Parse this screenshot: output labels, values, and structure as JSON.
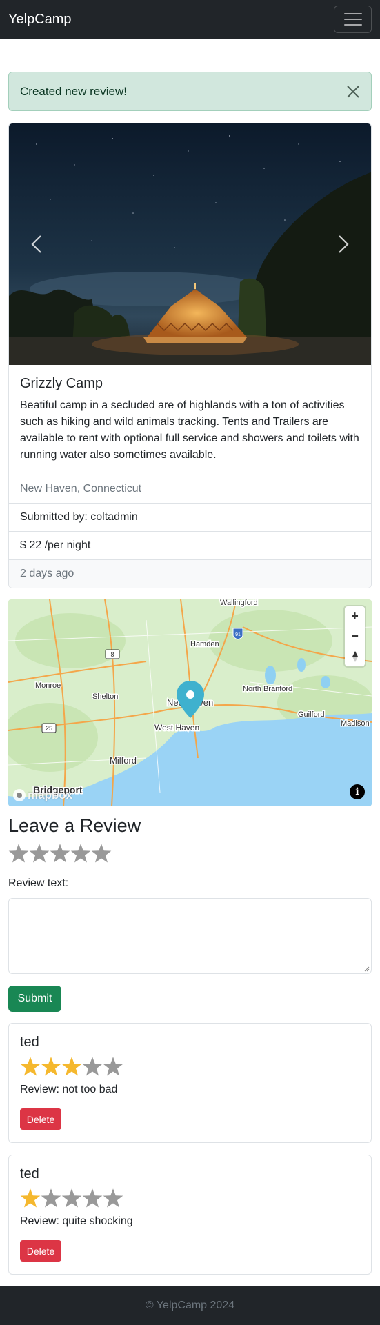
{
  "navbar": {
    "brand": "YelpCamp",
    "toggler_icon": "hamburger-icon"
  },
  "alert": {
    "message": "Created new review!",
    "close_icon": "close-icon"
  },
  "campground": {
    "title": "Grizzly Camp",
    "description": "Beatiful camp in a secluded are of highlands with a ton of activities such as hiking and wild animals tracking. Tents and Trailers are available to rent with optional full service and showers and toilets with running water also sometimes available.",
    "location": "New Haven, Connecticut",
    "submitted_by": "Submitted by: coltadmin",
    "price": "$ 22 /per night",
    "posted": "2 days ago"
  },
  "map": {
    "labels": {
      "wallingford": "Wallingford",
      "hamden": "Hamden",
      "monroe": "Monroe",
      "shelton": "Shelton",
      "new_haven": "New Haven",
      "north_branford": "North Branford",
      "guilford": "Guilford",
      "madison": "Madison",
      "west_haven": "West Haven",
      "milford": "Milford",
      "bridgeport": "Bridgeport",
      "route_8": "8",
      "route_25": "25",
      "route_91": "91"
    },
    "zoom_in": "+",
    "zoom_out": "−",
    "logo": "mapbox",
    "attribution": "i"
  },
  "review_form": {
    "heading": "Leave a Review",
    "rating_label": "Review text:",
    "submit_label": "Submit"
  },
  "reviews": [
    {
      "author": "ted",
      "rating": 3,
      "text": "Review: not too bad",
      "delete_label": "Delete"
    },
    {
      "author": "ted",
      "rating": 1,
      "text": "Review: quite shocking",
      "delete_label": "Delete"
    }
  ],
  "colors": {
    "star_filled": "#f5b82e",
    "star_empty": "#999999",
    "success": "#198754",
    "danger": "#dc3545"
  },
  "footer": {
    "text": "© YelpCamp 2024"
  }
}
